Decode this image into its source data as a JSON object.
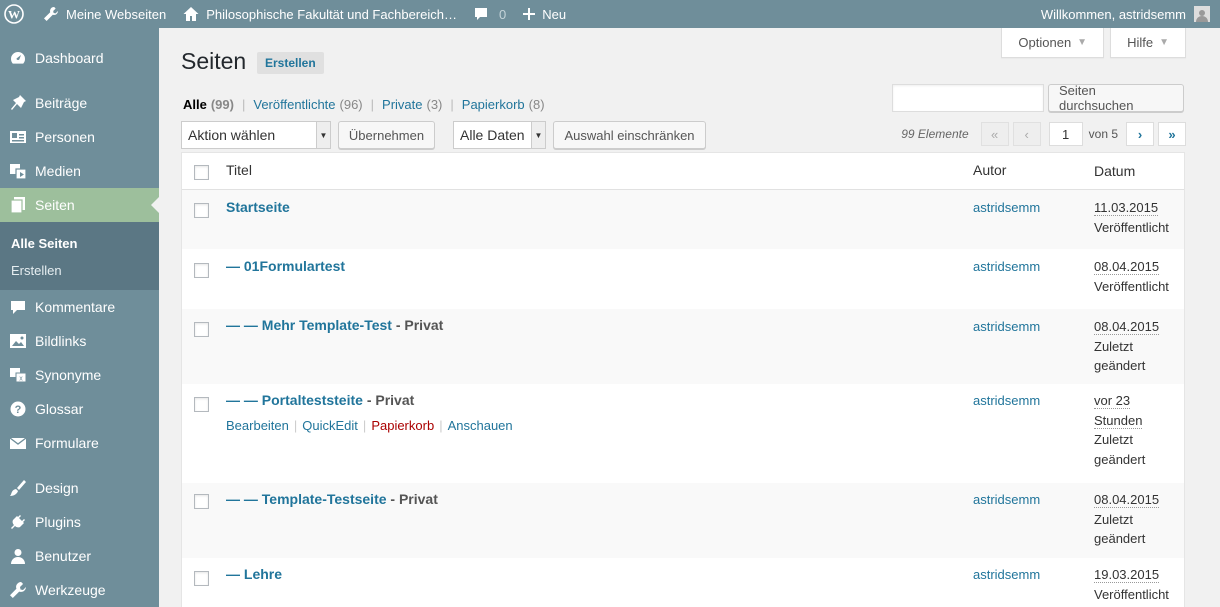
{
  "adminbar": {
    "my_sites": "Meine Webseiten",
    "site_name": "Philosophische Fakultät und Fachbereich…",
    "comments_count": "0",
    "new_label": "Neu",
    "welcome": "Willkommen, astridsemm"
  },
  "sidebar": {
    "items": [
      {
        "label": "Dashboard",
        "icon": "dashboard-icon"
      },
      {
        "label": "Beiträge",
        "icon": "pin-icon"
      },
      {
        "label": "Personen",
        "icon": "id-card-icon"
      },
      {
        "label": "Medien",
        "icon": "media-icon"
      },
      {
        "label": "Seiten",
        "icon": "pages-icon",
        "current": true
      },
      {
        "label": "Kommentare",
        "icon": "comment-icon"
      },
      {
        "label": "Bildlinks",
        "icon": "image-icon"
      },
      {
        "label": "Synonyme",
        "icon": "translation-icon"
      },
      {
        "label": "Glossar",
        "icon": "help-icon"
      },
      {
        "label": "Formulare",
        "icon": "mail-icon"
      },
      {
        "label": "Design",
        "icon": "brush-icon"
      },
      {
        "label": "Plugins",
        "icon": "plugin-icon"
      },
      {
        "label": "Benutzer",
        "icon": "user-icon"
      },
      {
        "label": "Werkzeuge",
        "icon": "wrench-icon"
      }
    ],
    "submenu": [
      {
        "label": "Alle Seiten",
        "active": true
      },
      {
        "label": "Erstellen"
      }
    ]
  },
  "screen_tabs": {
    "options": "Optionen",
    "help": "Hilfe"
  },
  "page": {
    "title": "Seiten",
    "add_new": "Erstellen"
  },
  "views": [
    {
      "label": "Alle",
      "count": "(99)",
      "current": true
    },
    {
      "label": "Veröffentlichte",
      "count": "(96)"
    },
    {
      "label": "Private",
      "count": "(3)"
    },
    {
      "label": "Papierkorb",
      "count": "(8)"
    }
  ],
  "search": {
    "button": "Seiten durchsuchen",
    "value": ""
  },
  "tablenav": {
    "bulk_action": "Aktion wählen",
    "apply": "Übernehmen",
    "dates": "Alle Daten",
    "filter": "Auswahl einschränken",
    "items_count": "99 Elemente",
    "first": "«",
    "prev": "‹",
    "current_page": "1",
    "total_pages": "von 5",
    "next": "›",
    "last": "»"
  },
  "table": {
    "columns": {
      "title": "Titel",
      "author": "Autor",
      "date": "Datum"
    },
    "rows": [
      {
        "title": "Startseite",
        "state": "",
        "author": "astridsemm",
        "date": "11.03.2015",
        "status": "Veröffentlicht"
      },
      {
        "title": "— 01Formulartest",
        "state": "",
        "author": "astridsemm",
        "date": "08.04.2015",
        "status": "Veröffentlicht"
      },
      {
        "title": "— — Mehr Template-Test",
        "state": " - Privat",
        "author": "astridsemm",
        "date": "08.04.2015",
        "status": "Zuletzt geändert"
      },
      {
        "title": "— — Portalteststeite",
        "state": " - Privat",
        "author": "astridsemm",
        "date": "vor 23 Stunden",
        "status": "Zuletzt geändert",
        "actions": [
          "Bearbeiten",
          "QuickEdit",
          "Papierkorb",
          "Anschauen"
        ]
      },
      {
        "title": "— — Template-Testseite",
        "state": " - Privat",
        "author": "astridsemm",
        "date": "08.04.2015",
        "status": "Zuletzt geändert"
      },
      {
        "title": "— Lehre",
        "state": "",
        "author": "astridsemm",
        "date": "19.03.2015",
        "status": "Veröffentlicht"
      }
    ]
  },
  "colors": {
    "adminbar": "#6f8e9a",
    "sidebar": "#6f8e9a",
    "current_menu": "#9dbf9c",
    "link": "#21759b",
    "trash": "#a00000"
  }
}
